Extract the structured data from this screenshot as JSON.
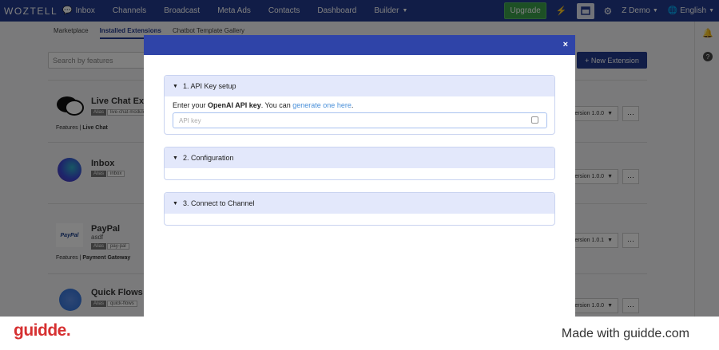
{
  "nav": {
    "logo": "WOZTELL",
    "items": [
      "Inbox",
      "Channels",
      "Broadcast",
      "Meta Ads",
      "Contacts",
      "Dashboard",
      "Builder"
    ],
    "upgrade": "Upgrade",
    "account": "Z Demo",
    "language": "English"
  },
  "subtabs": [
    "Marketplace",
    "Installed Extensions",
    "Chatbot Template Gallery"
  ],
  "search_placeholder": "Search by features",
  "new_extension": "+ New Extension",
  "extensions": [
    {
      "name": "Live Chat Ext",
      "alias_key": "Alias",
      "alias": "live-chat-module",
      "features_label": "Features | ",
      "features": "Live Chat",
      "version": "ersion 1.0.0",
      "icon_color": "#111111"
    },
    {
      "name": "Inbox",
      "alias_key": "Alias",
      "alias": "inbox",
      "version": "ersion 1.0.0",
      "icon_color": "#3b4bd6"
    },
    {
      "name": "PayPal",
      "sub": "asdf",
      "alias_key": "Alias",
      "alias": "pay-pal",
      "features_label": "Features | ",
      "features": "Payment Gateway",
      "version": "ersion 1.0.1",
      "icon_color": "#ffffff"
    },
    {
      "name": "Quick Flows",
      "alias_key": "Alias",
      "alias": "quick-flows",
      "version": "ersion 1.0.0",
      "icon_color": "#2c6fd9"
    }
  ],
  "modal": {
    "close": "×",
    "sections": [
      {
        "title": "1. API Key setup"
      },
      {
        "title": "2. Configuration"
      },
      {
        "title": "3. Connect to Channel"
      }
    ],
    "api_text_pre": "Enter your ",
    "api_text_bold": "OpenAI API key",
    "api_text_mid": ". You can ",
    "api_link": "generate one here",
    "api_text_end": ".",
    "api_placeholder": "API key"
  },
  "footer": {
    "brand": "guidde.",
    "made_with": "Made with guidde.com"
  }
}
